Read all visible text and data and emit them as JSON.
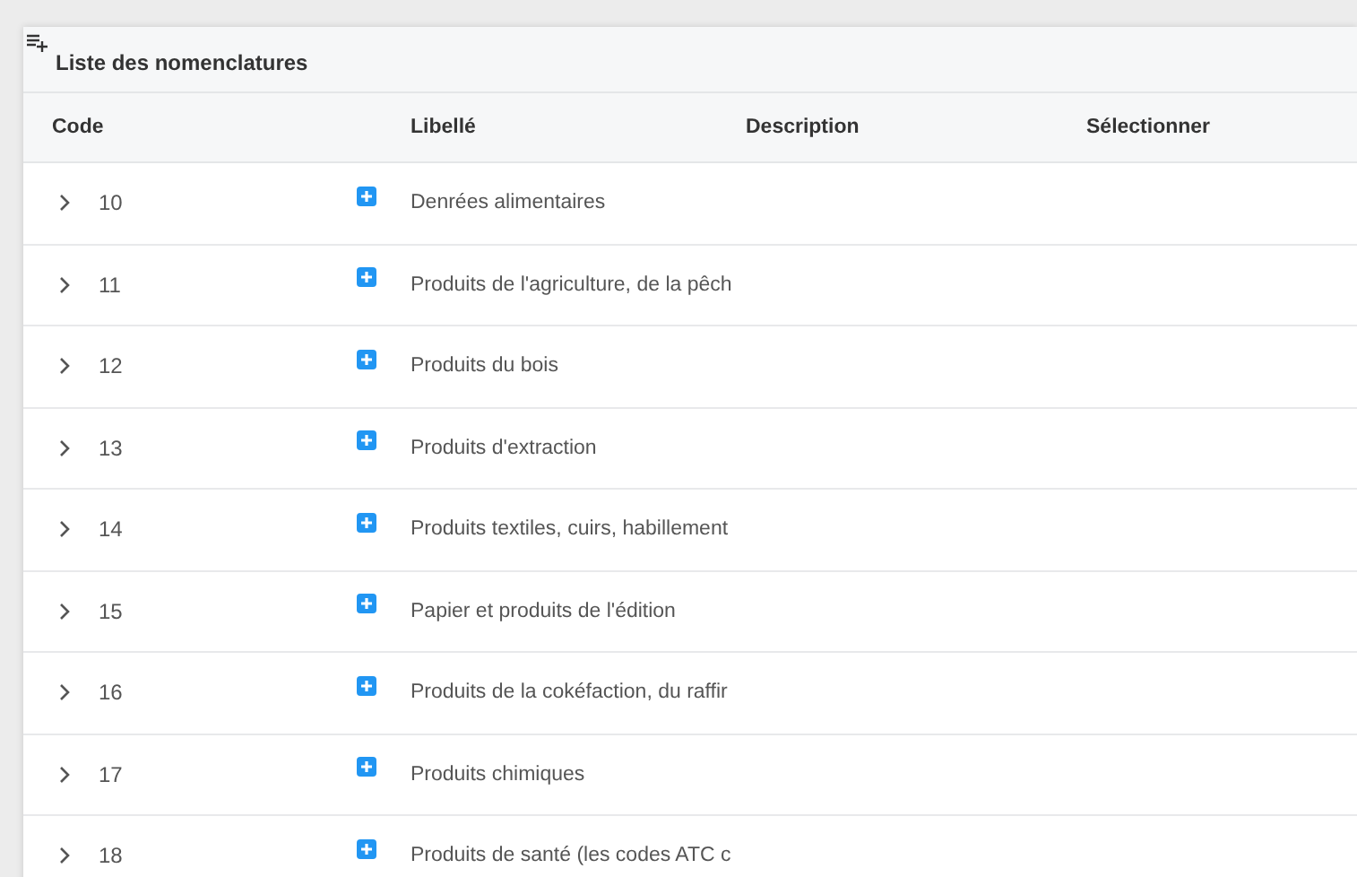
{
  "panel": {
    "title": "Liste des nomenclatures"
  },
  "table": {
    "columns": [
      "Code",
      "Libellé",
      "Description",
      "Sélectionner"
    ],
    "rows": [
      {
        "code": "10",
        "label": "Denrées alimentaires",
        "expanded": false
      },
      {
        "code": "11",
        "label": "Produits de l'agriculture, de la pêch",
        "expanded": false
      },
      {
        "code": "12",
        "label": "Produits du bois",
        "expanded": false
      },
      {
        "code": "13",
        "label": "Produits d'extraction",
        "expanded": false
      },
      {
        "code": "14",
        "label": "Produits textiles, cuirs, habillement",
        "expanded": false
      },
      {
        "code": "15",
        "label": "Papier et produits de l'édition",
        "expanded": false
      },
      {
        "code": "16",
        "label": "Produits de la cokéfaction, du raffir",
        "expanded": false
      },
      {
        "code": "17",
        "label": "Produits chimiques",
        "expanded": false
      },
      {
        "code": "18",
        "label": "Produits de santé (les codes ATC c",
        "expanded": false
      }
    ]
  }
}
